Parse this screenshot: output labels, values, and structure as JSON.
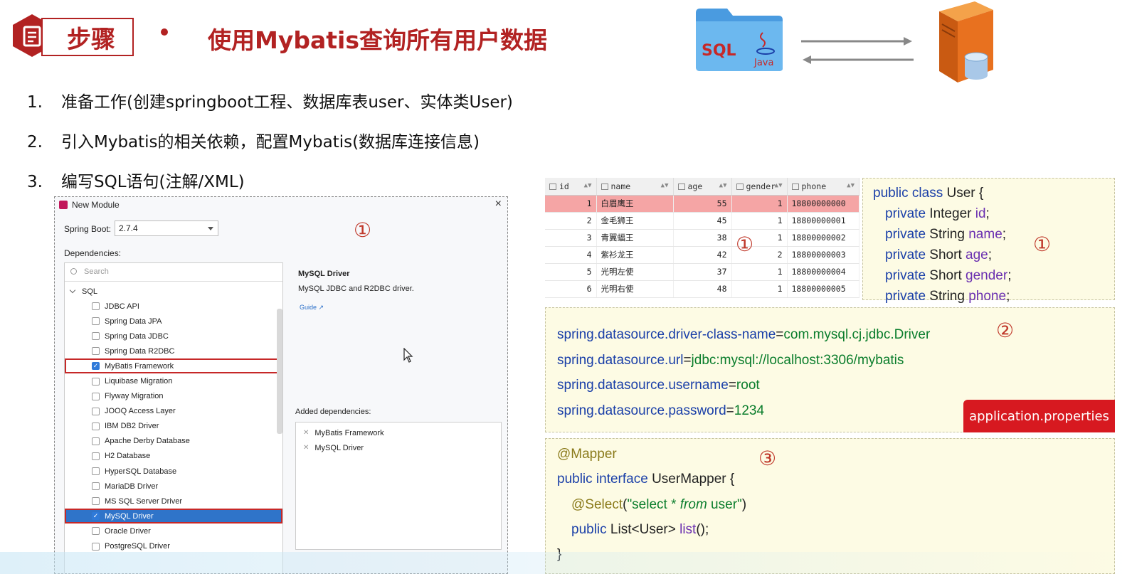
{
  "header": {
    "badge": "步骤",
    "title": "使用Mybatis查询所有用户数据"
  },
  "graphic": {
    "folder_sql": "SQL",
    "folder_java": "Java",
    "colors": {
      "accent": "#b22222",
      "folder": "#5aa9e6",
      "server": "#e8711f"
    }
  },
  "steps": [
    {
      "num": "1.",
      "text": "准备工作(创建springboot工程、数据库表user、实体类User)"
    },
    {
      "num": "2.",
      "text": "引入Mybatis的相关依赖，配置Mybatis(数据库连接信息)"
    },
    {
      "num": "3.",
      "text": "编写SQL语句(注解/XML)"
    }
  ],
  "dialog": {
    "title": "New Module",
    "spring_boot_label": "Spring Boot:",
    "spring_boot_value": "2.7.4",
    "circle": "①",
    "dependencies_label": "Dependencies:",
    "search_placeholder": "Search",
    "group": "SQL",
    "deps": [
      {
        "label": "JDBC API",
        "checked": false
      },
      {
        "label": "Spring Data JPA",
        "checked": false
      },
      {
        "label": "Spring Data JDBC",
        "checked": false
      },
      {
        "label": "Spring Data R2DBC",
        "checked": false
      },
      {
        "label": "MyBatis Framework",
        "checked": true
      },
      {
        "label": "Liquibase Migration",
        "checked": false
      },
      {
        "label": "Flyway Migration",
        "checked": false
      },
      {
        "label": "JOOQ Access Layer",
        "checked": false
      },
      {
        "label": "IBM DB2 Driver",
        "checked": false
      },
      {
        "label": "Apache Derby Database",
        "checked": false
      },
      {
        "label": "H2 Database",
        "checked": false
      },
      {
        "label": "HyperSQL Database",
        "checked": false
      },
      {
        "label": "MariaDB Driver",
        "checked": false
      },
      {
        "label": "MS SQL Server Driver",
        "checked": false
      },
      {
        "label": "MySQL Driver",
        "checked": true
      },
      {
        "label": "Oracle Driver",
        "checked": false
      },
      {
        "label": "PostgreSQL Driver",
        "checked": false
      }
    ],
    "info_title": "MySQL Driver",
    "info_desc": "MySQL JDBC and R2DBC driver.",
    "info_guide": "Guide ↗",
    "added_label": "Added dependencies:",
    "added": [
      "MyBatis Framework",
      "MySQL Driver"
    ]
  },
  "table": {
    "columns": [
      "id",
      "name",
      "age",
      "gender",
      "phone"
    ],
    "rows": [
      [
        "1",
        "白眉鹰王",
        "55",
        "1",
        "18800000000"
      ],
      [
        "2",
        "金毛狮王",
        "45",
        "1",
        "18800000001"
      ],
      [
        "3",
        "青翼蝠王",
        "38",
        "1",
        "18800000002"
      ],
      [
        "4",
        "紫衫龙王",
        "42",
        "2",
        "18800000003"
      ],
      [
        "5",
        "光明左使",
        "37",
        "1",
        "18800000004"
      ],
      [
        "6",
        "光明右使",
        "48",
        "1",
        "18800000005"
      ]
    ],
    "circle": "①"
  },
  "user_class": {
    "l1_kw": "public class",
    "l1_name": " User {",
    "fields": [
      {
        "mod": "private",
        "type": " Integer ",
        "name": "id",
        "end": ";"
      },
      {
        "mod": "private",
        "type": " String ",
        "name": "name",
        "end": ";"
      },
      {
        "mod": "private",
        "type": " Short ",
        "name": "age",
        "end": ";"
      },
      {
        "mod": "private",
        "type": " Short ",
        "name": "gender",
        "end": ";"
      },
      {
        "mod": "private",
        "type": " String ",
        "name": "phone",
        "end": ";"
      }
    ],
    "circle": "①"
  },
  "props": {
    "lines": [
      {
        "key": "spring.datasource.driver-class-name",
        "eq": "=",
        "val": "com.mysql.cj.jdbc.Driver"
      },
      {
        "key": "spring.datasource.url",
        "eq": "=",
        "val": "jdbc:mysql://localhost:3306/mybatis"
      },
      {
        "key": "spring.datasource.username",
        "eq": "=",
        "val": "root"
      },
      {
        "key": "spring.datasource.password",
        "eq": "=",
        "val": "1234"
      }
    ],
    "circle": "②",
    "badge": "application.properties"
  },
  "mapper": {
    "annotation": "@Mapper",
    "l2_kw": "public interface",
    "l2_name": " UserMapper {",
    "l3_ann": "@Select",
    "l3_open": "(",
    "l3_str_a": "\"select * ",
    "l3_kw": "from",
    "l3_str_b": " user\"",
    "l3_close": ")",
    "l4_kw": "public",
    "l4_type": " List<User> ",
    "l4_method": "list",
    "l4_end": "();",
    "l5": "}",
    "circle": "③"
  }
}
